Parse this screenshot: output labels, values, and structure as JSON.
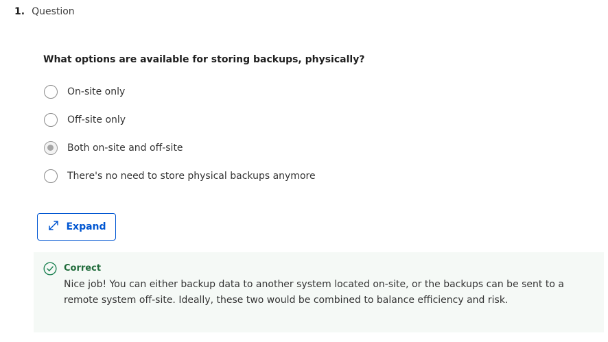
{
  "question": {
    "number": "1.",
    "label": "Question",
    "prompt": "What options are available for storing backups, physically?",
    "options": [
      {
        "label": "On-site only",
        "selected": false
      },
      {
        "label": "Off-site only",
        "selected": false
      },
      {
        "label": "Both on-site and off-site",
        "selected": true
      },
      {
        "label": "There's no need to store physical backups anymore",
        "selected": false
      }
    ]
  },
  "expand": {
    "label": "Expand",
    "icon": "expand-arrows-icon"
  },
  "feedback": {
    "status": "Correct",
    "icon": "check-circle-icon",
    "message": "Nice job! You can either backup data to another system located on-site, or the backups can be sent to a remote system off-site. Ideally, these two would be combined to balance efficiency and risk.",
    "accent_color": "#1f8354"
  },
  "colors": {
    "primary": "#0056d2",
    "success": "#1f8354"
  }
}
